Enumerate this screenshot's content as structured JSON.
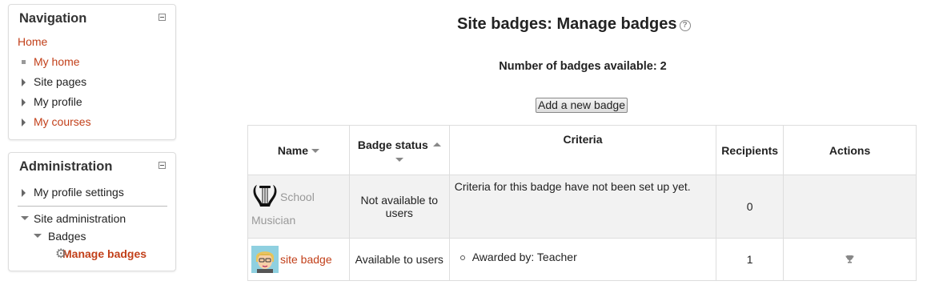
{
  "navigation": {
    "title": "Navigation",
    "home": "Home",
    "items": [
      {
        "label": "My home"
      },
      {
        "label": "Site pages"
      },
      {
        "label": "My profile"
      },
      {
        "label": "My courses"
      }
    ]
  },
  "administration": {
    "title": "Administration",
    "profile_settings": "My profile settings",
    "site_admin": "Site administration",
    "badges": "Badges",
    "manage_badges": "Manage badges"
  },
  "page": {
    "title": "Site badges: Manage badges",
    "help_glyph": "?",
    "count_text": "Number of badges available: 2",
    "add_button": "Add a new badge"
  },
  "table": {
    "headers": {
      "name": "Name",
      "status": "Badge status",
      "criteria": "Criteria",
      "recipients": "Recipients",
      "actions": "Actions"
    },
    "rows": [
      {
        "name": "School Musician",
        "status": "Not available to users",
        "criteria": "Criteria for this badge have not been set up yet.",
        "recipients": "0"
      },
      {
        "name": "site badge",
        "status": "Available to users",
        "criteria_item": "Awarded by: Teacher",
        "recipients": "1",
        "action_icon": "trophy-icon"
      }
    ]
  },
  "colors": {
    "link": "#c2401a",
    "row_shade": "#f2f2f2",
    "muted": "#999999"
  }
}
